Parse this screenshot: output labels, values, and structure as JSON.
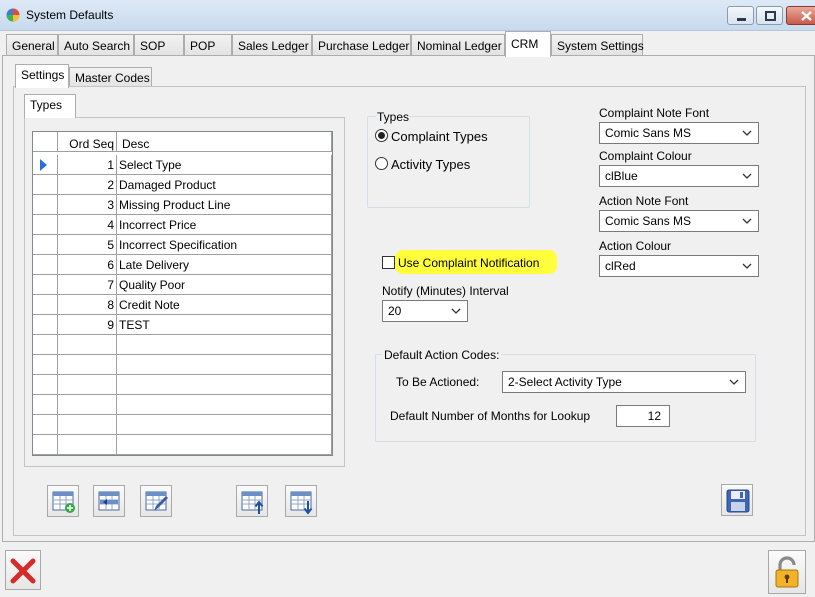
{
  "window": {
    "title": "System Defaults"
  },
  "main_tabs": [
    "General",
    "Auto Search",
    "SOP",
    "POP",
    "Sales Ledger",
    "Purchase Ledger",
    "Nominal Ledger",
    "CRM",
    "System Settings"
  ],
  "main_active_tab": "CRM",
  "sub_tabs": [
    "Settings",
    "Master Codes"
  ],
  "inner_tab": "Types",
  "grid": {
    "headers": {
      "ord_seq": "Ord Seq",
      "desc": "Desc"
    },
    "rows": [
      {
        "seq": "1",
        "desc": "Select Type"
      },
      {
        "seq": "2",
        "desc": "Damaged Product"
      },
      {
        "seq": "3",
        "desc": "Missing Product Line"
      },
      {
        "seq": "4",
        "desc": "Incorrect Price"
      },
      {
        "seq": "5",
        "desc": "Incorrect Specification"
      },
      {
        "seq": "6",
        "desc": "Late Delivery"
      },
      {
        "seq": "7",
        "desc": "Quality Poor"
      },
      {
        "seq": "8",
        "desc": "Credit Note"
      },
      {
        "seq": "9",
        "desc": "TEST"
      }
    ],
    "selected_row": 0
  },
  "types_group": {
    "label": "Types",
    "complaint": "Complaint Types",
    "activity": "Activity Types",
    "selected": "complaint"
  },
  "notification": {
    "checkbox_label": "Use Complaint Notification",
    "checked": false,
    "interval_label": "Notify (Minutes) Interval",
    "interval_value": "20"
  },
  "fonts": {
    "complaint_font_label": "Complaint Note Font",
    "complaint_font_value": "Comic Sans MS",
    "complaint_colour_label": "Complaint Colour",
    "complaint_colour_value": "clBlue",
    "action_font_label": "Action Note Font",
    "action_font_value": "Comic Sans MS",
    "action_colour_label": "Action Colour",
    "action_colour_value": "clRed"
  },
  "default_action": {
    "label": "Default Action Codes:",
    "to_be_actioned_label": "To Be Actioned:",
    "to_be_actioned_value": "2-Select Activity Type",
    "months_label": "Default Number of Months for Lookup",
    "months_value": "12"
  },
  "colors": {
    "highlight": "#ffff3c",
    "selected_arrow": "#2a6fd6"
  }
}
